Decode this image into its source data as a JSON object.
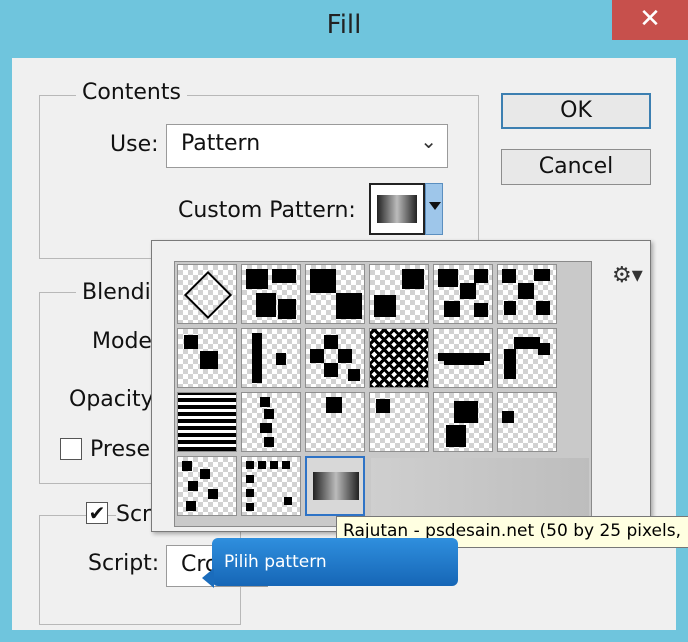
{
  "window": {
    "title": "Fill",
    "close_glyph": "✕"
  },
  "contents": {
    "group_label": "Contents",
    "use_label": "Use:",
    "use_value": "Pattern",
    "custom_pattern_label": "Custom Pattern:"
  },
  "buttons": {
    "ok": "OK",
    "cancel": "Cancel"
  },
  "blending": {
    "group_label": "Blendi",
    "mode_label": "Mode",
    "opacity_label": "Opacity",
    "preserve_label": "Preser"
  },
  "script": {
    "checkbox_label": "Scr",
    "script_label": "Script:",
    "script_value": "Cro"
  },
  "pattern_popup": {
    "gear_glyph": "⚙▾",
    "tooltip": "Rajutan - psdesain.net (50 by 25 pixels,",
    "selected_index": 14
  },
  "callout": {
    "text": "Pilih pattern"
  },
  "colors": {
    "title_bar": "#6fc5dd",
    "close_button": "#c7504c",
    "selection_border": "#2e73c6",
    "callout_blue": "#1f7acb",
    "tooltip_bg": "#ffffe1"
  }
}
